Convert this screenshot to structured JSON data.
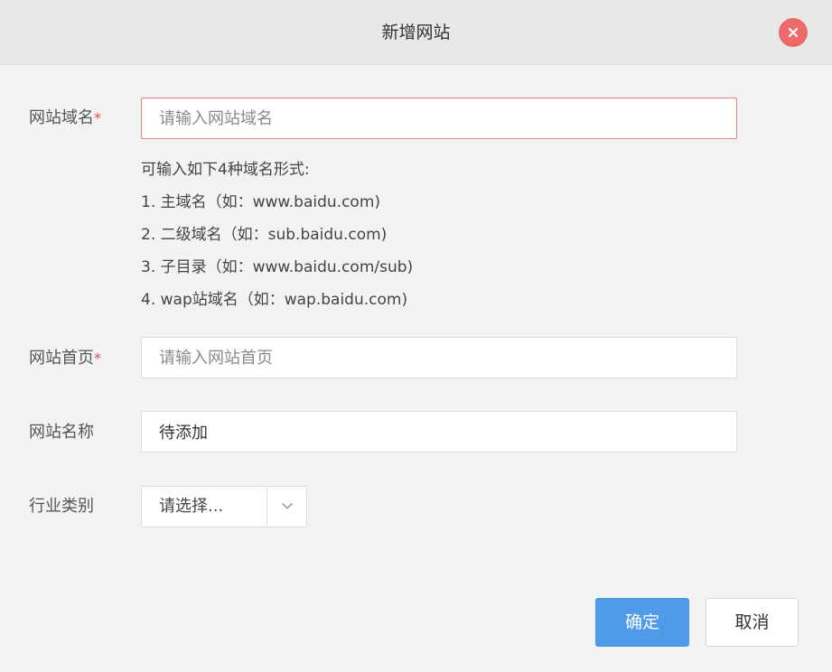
{
  "dialog": {
    "title": "新增网站",
    "close_icon": "close-icon",
    "accent_color": "#4f9be9",
    "close_color": "#ed6a6a",
    "required_mark_color": "#e5484d"
  },
  "form": {
    "domain": {
      "label": "网站域名",
      "required_mark": "*",
      "placeholder": "请输入网站域名",
      "value": ""
    },
    "hints": [
      "可输入如下4种域名形式:",
      "1. 主域名（如：www.baidu.com)",
      "2. 二级域名（如：sub.baidu.com)",
      "3. 子目录（如：www.baidu.com/sub)",
      "4. wap站域名（如：wap.baidu.com)"
    ],
    "homepage": {
      "label": "网站首页",
      "required_mark": "*",
      "placeholder": "请输入网站首页",
      "value": ""
    },
    "site_name": {
      "label": "网站名称",
      "placeholder": "",
      "value": "待添加"
    },
    "industry": {
      "label": "行业类别",
      "selected": "请选择...",
      "icon": "chevron-down-icon"
    }
  },
  "footer": {
    "confirm_label": "确定",
    "cancel_label": "取消"
  }
}
